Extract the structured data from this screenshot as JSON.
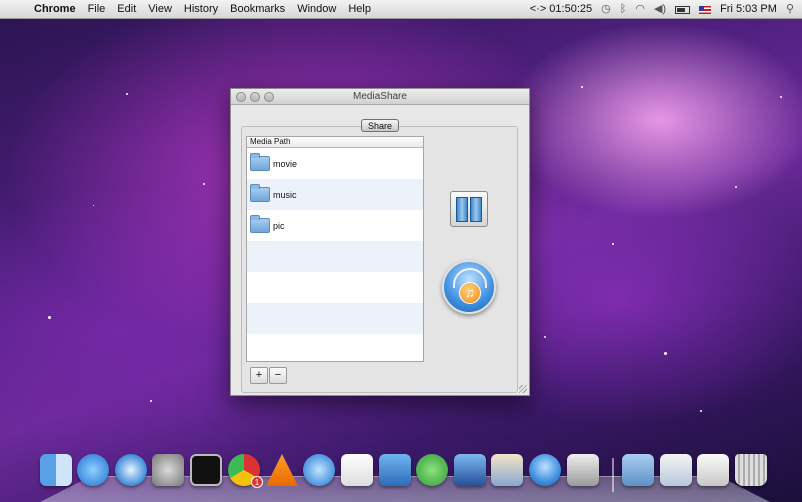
{
  "menubar": {
    "apple_icon": "apple-icon",
    "app_name": "Chrome",
    "items": [
      "File",
      "Edit",
      "View",
      "History",
      "Bookmarks",
      "Window",
      "Help"
    ],
    "timer": "<·> 01:50:25",
    "clock": "Fri 5:03 PM"
  },
  "window": {
    "title": "MediaShare",
    "share_button": "Share",
    "list_header": "Media Path",
    "items": [
      {
        "label": "movie"
      },
      {
        "label": "music"
      },
      {
        "label": "pic"
      }
    ],
    "add_button": "+",
    "remove_button": "−"
  },
  "dock": {
    "icons": [
      "finder-icon",
      "app-store-icon",
      "safari-icon",
      "system-preferences-icon",
      "terminal-icon",
      "chrome-icon",
      "vlc-icon",
      "itunes-icon",
      "textedit-icon",
      "xcode-icon",
      "messenger-icon",
      "simulator-icon",
      "preview-icon",
      "mediashare-icon",
      "installer-icon",
      "applications-folder-icon",
      "documents-icon",
      "downloads-icon",
      "trash-icon"
    ],
    "chrome_badge": "1"
  }
}
